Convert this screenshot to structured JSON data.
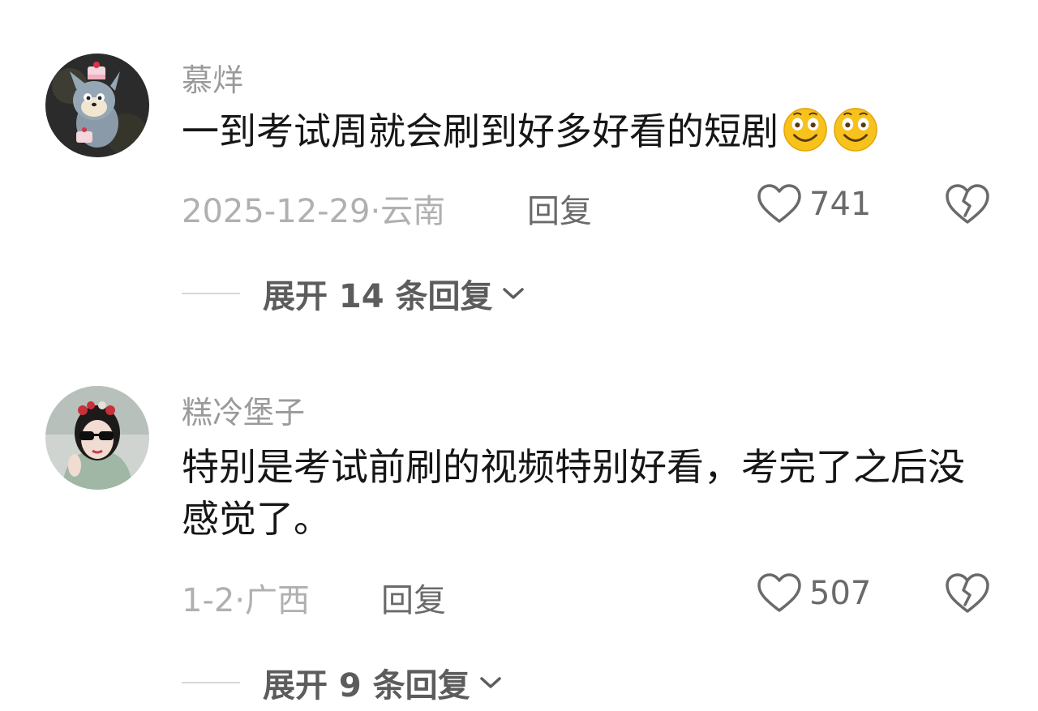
{
  "comments": [
    {
      "username": "慕烊",
      "text": "一到考试周就会刷到好多好看的短剧",
      "emojis": [
        "smile-emoji",
        "smile-emoji"
      ],
      "time_location": "2025-12-29·云南",
      "reply_label": "回复",
      "likes": "741",
      "expand_label": "展开 14 条回复"
    },
    {
      "username": "糕冷堡子",
      "text": "特别是考试前刷的视频特别好看，考完了之后没感觉了。",
      "time_location": "1-2·广西",
      "reply_label": "回复",
      "likes": "507",
      "expand_label": "展开 9 条回复"
    }
  ],
  "icons": {
    "like": "heart-outline-icon",
    "dislike": "broken-heart-icon",
    "expand": "chevron-down-icon"
  },
  "colors": {
    "username": "#9a9a9a",
    "text": "#161616",
    "meta": "#b0b0b0",
    "action": "#6a6a6a",
    "emoji": "#f7c21c"
  }
}
